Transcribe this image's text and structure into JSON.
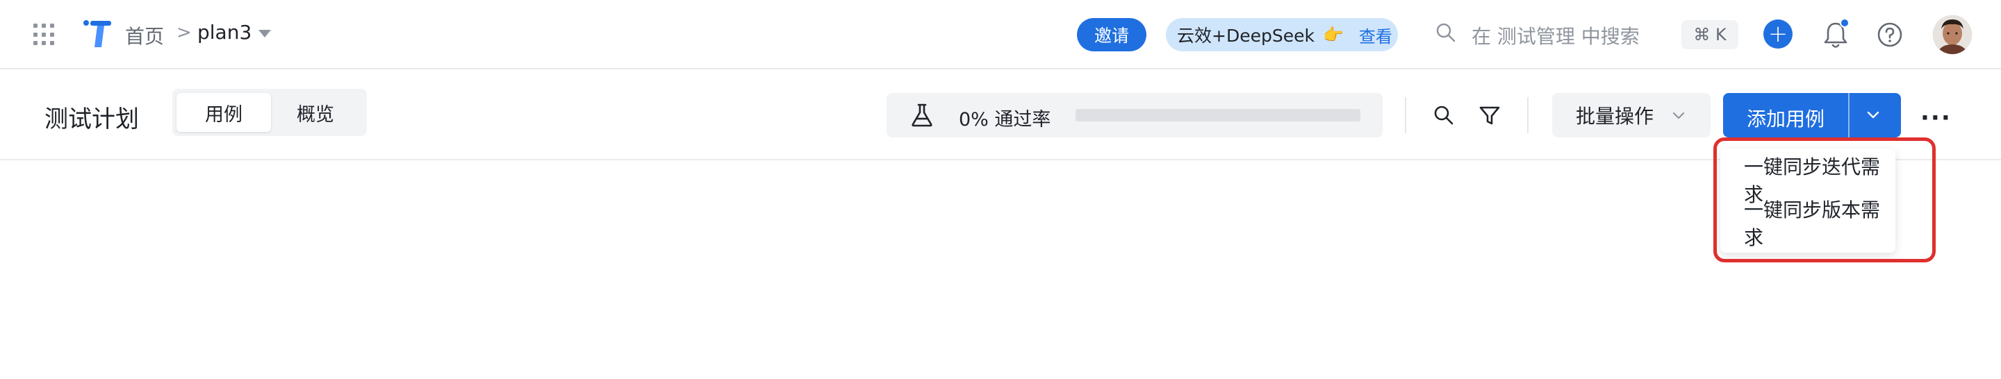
{
  "topbar": {
    "breadcrumb_home": "首页",
    "breadcrumb_sep": ">",
    "project_name": "plan3",
    "invite_label": "邀请",
    "promo_text": "云效+DeepSeek",
    "promo_emoji": "👉",
    "promo_link": "查看",
    "search_placeholder": "在 测试管理 中搜索",
    "shortcut": "⌘ K",
    "plus_label": "+",
    "icons": [
      "apps-grid-icon",
      "logo-icon",
      "search-icon",
      "plus-icon",
      "bell-icon",
      "help-icon",
      "avatar"
    ]
  },
  "page": {
    "title": "测试计划",
    "tabs": [
      {
        "label": "用例",
        "active": true
      },
      {
        "label": "概览",
        "active": false
      }
    ],
    "pass_rate_text": "0% 通过率",
    "pass_rate_value": 0,
    "batch_label": "批量操作",
    "add_label": "添加用例",
    "more_label": "···"
  },
  "dropdown": {
    "items": [
      "一键同步迭代需求",
      "一键同步版本需求"
    ]
  },
  "colors": {
    "primary": "#1f6fe0",
    "promo_bg": "#cfe5fb",
    "highlight": "#e02f2f"
  }
}
